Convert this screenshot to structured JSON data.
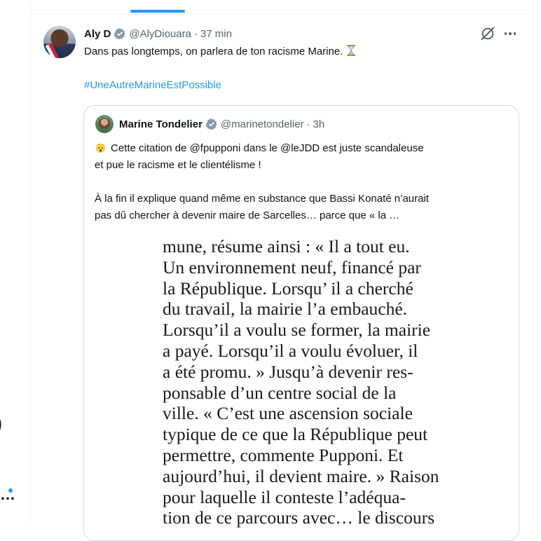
{
  "tweet": {
    "author_name": "Aly D",
    "handle": "@AlyDiouara",
    "time": "37 min",
    "text": "Dans pas longtemps, on parlera de ton racisme Marine.",
    "hashtag": "#UneAutreMarineEstPossible"
  },
  "quoted_tweet": {
    "author_name": "Marine Tondelier",
    "handle": "@marinetondelier",
    "time": "3h",
    "line1": "Cette citation de @fpupponi dans le @leJDD est juste scandaleuse",
    "line2": "et pue le racisme et le clientélisme !",
    "line3": "À la fin il explique quand même en substance que Bassi Konaté n’aurait",
    "line4": "pas dû chercher à devenir maire de Sarcelles… parce que « la …",
    "image_lines": [
      "mune, résume ainsi : « Il a tout eu.",
      "Un environnement neuf, financé par",
      "la République. Lorsqu’ il a cherché",
      "du travail, la mairie l’a embauché.",
      "Lorsqu’il a voulu se former, la mairie",
      "a payé. Lorsqu’il a voulu évoluer, il",
      "a été promu. » Jusqu’à devenir res-",
      "ponsable d’un centre social de la",
      "ville. « C’est une ascension sociale",
      "typique de ce que la République peut",
      "permettre, commente Pupponi. Et",
      "aujourd’hui, il devient maire. » Raison",
      "pour laquelle il conteste l’adéqua-",
      "tion de ce parcours avec… le discours"
    ]
  },
  "left_fragments": {
    "paren": ")",
    "dots": "…"
  },
  "icons": {
    "verified": "verified-badge-icon",
    "grok": "grok-icon",
    "more": "more-options-icon",
    "hourglass": "hourglass-icon",
    "emoji": "exploding-head-icon"
  },
  "colors": {
    "link": "#1d9bf0",
    "muted": "#536471",
    "text": "#0f1419",
    "border": "#cfd9de"
  }
}
